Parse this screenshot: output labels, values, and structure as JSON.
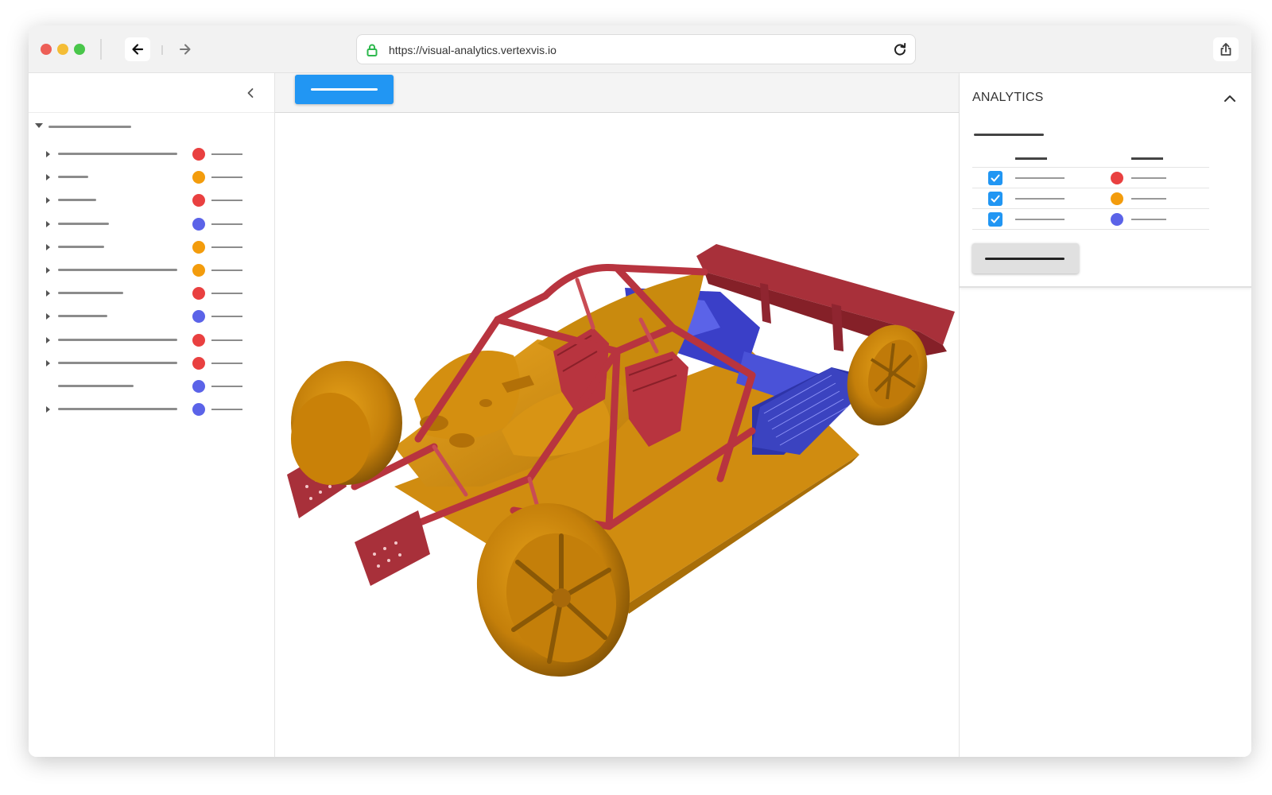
{
  "browser": {
    "url": "https://visual-analytics.vertexvis.io",
    "traffic_lights": [
      "#ed5f57",
      "#f4bd36",
      "#49c64a"
    ],
    "icons": {
      "back": "arrow-left-icon",
      "forward": "arrow-right-icon",
      "lock": "lock-icon",
      "reload": "reload-icon",
      "share": "share-icon"
    }
  },
  "colors": {
    "red": "#e94040",
    "orange": "#f39c0c",
    "blue": "#5b63e8",
    "accent": "#2196f3"
  },
  "scene_tree": {
    "rows": [
      {
        "color": "red",
        "expandable": true
      },
      {
        "color": "orange",
        "expandable": true
      },
      {
        "color": "red",
        "expandable": true
      },
      {
        "color": "blue",
        "expandable": true
      },
      {
        "color": "orange",
        "expandable": true
      },
      {
        "color": "orange",
        "expandable": true
      },
      {
        "color": "red",
        "expandable": true
      },
      {
        "color": "blue",
        "expandable": true
      },
      {
        "color": "red",
        "expandable": true
      },
      {
        "color": "red",
        "expandable": true
      },
      {
        "color": "blue",
        "expandable": false
      },
      {
        "color": "blue",
        "expandable": true
      }
    ]
  },
  "analytics": {
    "title": "ANALYTICS",
    "rows": [
      {
        "checked": true,
        "color": "red"
      },
      {
        "checked": true,
        "color": "orange"
      },
      {
        "checked": true,
        "color": "blue"
      }
    ]
  }
}
